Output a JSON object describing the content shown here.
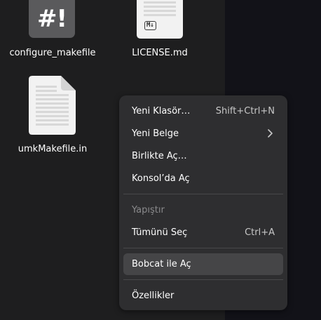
{
  "files": [
    {
      "name": "configure_makefile",
      "icon": "script-icon",
      "glyph": "#!"
    },
    {
      "name": "LICENSE.md",
      "icon": "markdown-file-icon",
      "badge": "M↓"
    },
    {
      "name": "umkMakefile.in",
      "icon": "text-file-icon"
    }
  ],
  "context_menu": {
    "items": [
      {
        "label": "Yeni Klasör…",
        "accel": "Shift+Ctrl+N"
      },
      {
        "label": "Yeni Belge",
        "submenu": true
      },
      {
        "label": "Birlikte Aç…"
      },
      {
        "label": "Konsol’da Aç"
      },
      {
        "label": "Yapıştır",
        "disabled": true
      },
      {
        "label": "Tümünü Seç",
        "accel": "Ctrl+A"
      },
      {
        "label": "Bobcat ile Aç",
        "highlighted": true
      },
      {
        "label": "Özellikler"
      }
    ]
  },
  "colors": {
    "background": "#1e1e1f",
    "right_background": "#121218",
    "menu_background": "#2e2e30",
    "highlight": "#454547"
  }
}
